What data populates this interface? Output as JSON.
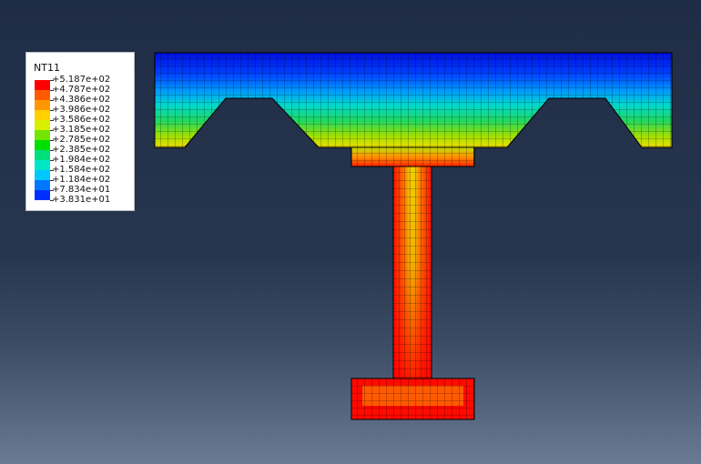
{
  "legend": {
    "title": "NT11",
    "entries": [
      {
        "label": "+5.187e+02",
        "color": "#ff0000"
      },
      {
        "label": "+4.787e+02",
        "color": "#ff5a00"
      },
      {
        "label": "+4.386e+02",
        "color": "#ff9800"
      },
      {
        "label": "+3.986e+02",
        "color": "#ffcf00"
      },
      {
        "label": "+3.586e+02",
        "color": "#d7f000"
      },
      {
        "label": "+3.185e+02",
        "color": "#72e600"
      },
      {
        "label": "+2.785e+02",
        "color": "#00e000"
      },
      {
        "label": "+2.385e+02",
        "color": "#00e07a"
      },
      {
        "label": "+1.984e+02",
        "color": "#00e8c8"
      },
      {
        "label": "+1.584e+02",
        "color": "#00c8ff"
      },
      {
        "label": "+1.184e+02",
        "color": "#0078ff"
      },
      {
        "label": "+7.834e+01",
        "color": "#0030ff"
      },
      {
        "label": "+3.831e+01",
        "color": ""
      }
    ]
  },
  "colors": {
    "deep_blue": "#0018e8",
    "blue": "#0050ff",
    "cyan": "#00c8e0",
    "green": "#30d000",
    "yellow": "#e0e000",
    "orange": "#ff8000",
    "red": "#ff0000",
    "mesh": "#000000"
  }
}
